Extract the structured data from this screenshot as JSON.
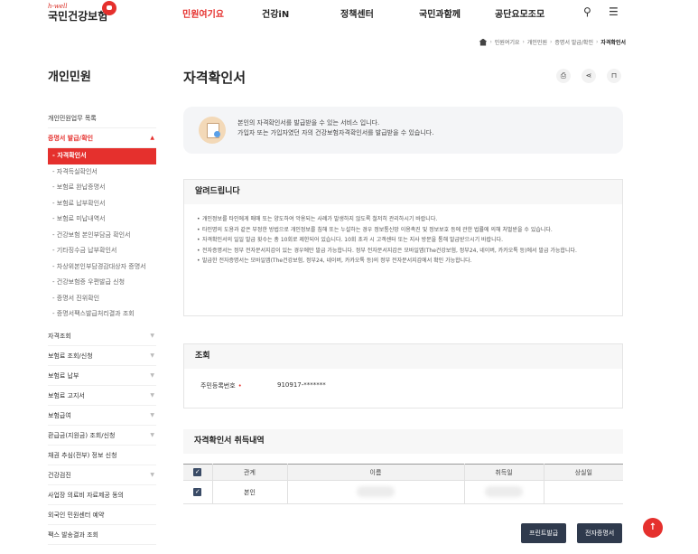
{
  "header": {
    "logo_small": "h-well",
    "logo_main": "국민건강보험",
    "nav": [
      "민원여기요",
      "건강iN",
      "정책센터",
      "국민과함께",
      "공단요모조모"
    ],
    "active_nav_color": "#e5302d"
  },
  "breadcrumb": [
    "민원여기요",
    "개인민원",
    "증명서 발급/확인",
    "자격확인서"
  ],
  "sidebar": {
    "title": "개인민원",
    "items": [
      {
        "label": "개인민원업무 목록",
        "type": "top"
      },
      {
        "label": "증명서 발급/확인",
        "type": "open"
      },
      {
        "label": "- 자격확인서",
        "type": "active"
      },
      {
        "label": "- 자격득실확인서",
        "type": "sub"
      },
      {
        "label": "- 보험료 완납증명서",
        "type": "sub"
      },
      {
        "label": "- 보험료 납부확인서",
        "type": "sub"
      },
      {
        "label": "- 보험료 미납내역서",
        "type": "sub"
      },
      {
        "label": "- 건강보험 본인부담금 확인서",
        "type": "sub"
      },
      {
        "label": "- 기타징수금 납부확인서",
        "type": "sub"
      },
      {
        "label": "- 차상위본인부담경감대상자 증명서",
        "type": "sub"
      },
      {
        "label": "- 건강보험증 우편발급 신청",
        "type": "sub"
      },
      {
        "label": "- 증명서 진위확인",
        "type": "sub"
      },
      {
        "label": "- 증명서팩스발급처리결과 조회",
        "type": "sub"
      },
      {
        "label": "자격조회",
        "type": "top"
      },
      {
        "label": "보험료 조회/신청",
        "type": "top"
      },
      {
        "label": "보험료 납부",
        "type": "top"
      },
      {
        "label": "보험료 고지서",
        "type": "top"
      },
      {
        "label": "보험급여",
        "type": "top"
      },
      {
        "label": "환급금(지원금) 조회/신청",
        "type": "top"
      },
      {
        "label": "채권 추심(전부) 정보 신청",
        "type": "top"
      },
      {
        "label": "건강검진",
        "type": "top"
      },
      {
        "label": "사업장 의료비 자료제공 동의",
        "type": "top"
      },
      {
        "label": "외국인 민원센터 예약",
        "type": "top"
      },
      {
        "label": "팩스 발송결과 조회",
        "type": "top"
      }
    ]
  },
  "main": {
    "title": "자격확인서",
    "intro": [
      "본인의 자격확인서를 발급받을 수 있는 서비스 입니다.",
      "가입자 또는 가입자였던 자의 건강보험자격확인서를 발급받을 수 있습니다."
    ],
    "notice_title": "알려드립니다",
    "notice_items": [
      "개인정보를 타인에게 매매 또는 양도하여 악용되는 사례가 발생하지 않도록 철저히 관리하시기 바랍니다.",
      "타인명의 도용과 같은 부정한 방법으로 개인정보를 침해 또는 누설하는 경우 정보통신망 이용촉진 및 정보보호 등에 관한 법률에 의해 처벌받을 수 있습니다.",
      "자격확인서의 일일 발급 횟수는 총 10회로 제한되어 있습니다. 10회 초과 시 고객센터 또는 지사 방문을 통해 발급받으시기 바랍니다.",
      "전자증명서는 정부 전자문서지갑이 있는 경우에만 발급 가능합니다. 정부 전자문서지갑은 모바일앱(The건강보험, 정부24, 네이버, 카카오톡 등)에서 발급 가능합니다.",
      "발급한 전자증명서는 모바일앱(The건강보험, 정부24, 네이버, 카카오톡 등)의 정부 전자문서지갑에서 확인 가능합니다."
    ],
    "inquiry_title": "조회",
    "inquiry_label": "주민등록번호",
    "inquiry_required": "•",
    "inquiry_value": "910917-*******",
    "history_title": "자격확인서 취득내역",
    "table_headers": [
      "관계",
      "이름",
      "취득일",
      "상실일"
    ],
    "table_rows": [
      {
        "relation": "본인"
      }
    ],
    "buttons": {
      "print": "프린트발급",
      "electronic": "전자증명서"
    }
  }
}
